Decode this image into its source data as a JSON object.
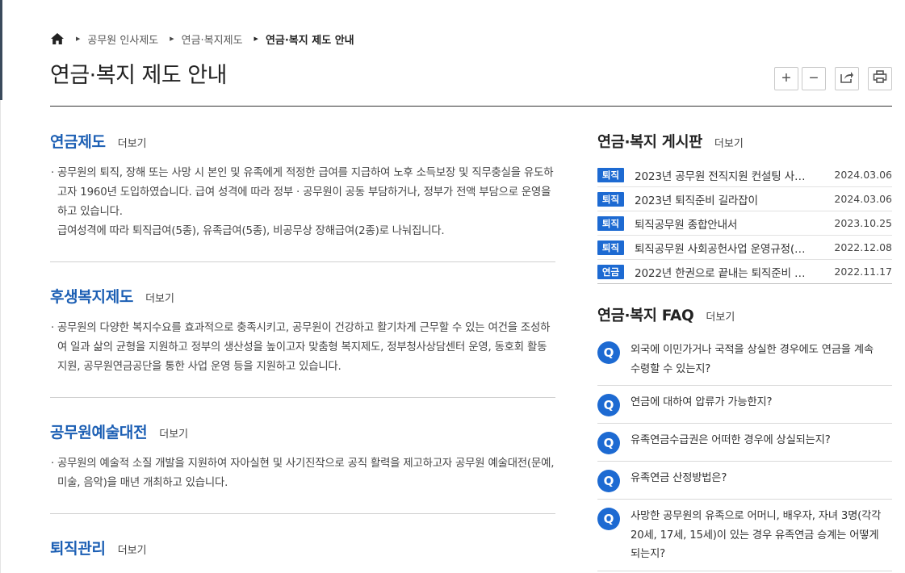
{
  "breadcrumb": {
    "items": [
      "공무원 인사제도",
      "연금·복지제도",
      "연금·복지 제도 안내"
    ]
  },
  "page": {
    "title": "연금·복지 제도 안내"
  },
  "tools": {
    "zoom_in": "+",
    "zoom_out": "−"
  },
  "more_label": "더보기",
  "sections": [
    {
      "title": "연금제도",
      "body": "공무원의 퇴직, 장해 또는 사망 시 본인 및 유족에게 적정한 급여를 지급하여 노후 소득보장 및 직무충실을 유도하고자 1960년 도입하였습니다. 급여 성격에 따라 정부 · 공무원이 공동 부담하거나, 정부가 전액 부담으로 운영을 하고 있습니다.",
      "body2": "급여성격에 따라 퇴직급여(5종), 유족급여(5종), 비공무상 장해급여(2종)로 나눠집니다."
    },
    {
      "title": "후생복지제도",
      "body": "공무원의 다양한 복지수요를 효과적으로 충족시키고, 공무원이 건강하고 활기차게 근무할 수 있는 여건을 조성하여 일과 삶의 균형을 지원하고 정부의 생산성을 높이고자 맞춤형 복지제도, 정부청사상담센터 운영, 동호회 활동 지원, 공무원연금공단을 통한 사업 운영 등을 지원하고 있습니다."
    },
    {
      "title": "공무원예술대전",
      "body": "공무원의 예술적 소질 개발을 지원하여 자아실현 및 사기진작으로 공직 활력을 제고하고자 공무원 예술대전(문예, 미술, 음악)을 매년 개최하고 있습니다."
    },
    {
      "title": "퇴직관리"
    }
  ],
  "board": {
    "title": "연금·복지 게시판",
    "items": [
      {
        "badge": "퇴직",
        "title": "2023년 공무원 전직지원 컨설팅 사…",
        "date": "2024.03.06"
      },
      {
        "badge": "퇴직",
        "title": "2023년 퇴직준비 길라잡이",
        "date": "2024.03.06"
      },
      {
        "badge": "퇴직",
        "title": "퇴직공무원 종합안내서",
        "date": "2023.10.25"
      },
      {
        "badge": "퇴직",
        "title": "퇴직공무원 사회공헌사업 운영규정(…",
        "date": "2022.12.08"
      },
      {
        "badge": "연금",
        "title": "2022년 한권으로 끝내는 퇴직준비 …",
        "date": "2022.11.17"
      }
    ]
  },
  "faq": {
    "title": "연금·복지 FAQ",
    "q_label": "Q",
    "items": [
      "외국에 이민가거나 국적을 상실한 경우에도 연금을 계속 수령할 수 있는지?",
      "연금에 대하여 압류가 가능한지?",
      "유족연금수급권은 어떠한 경우에 상실되는지?",
      "유족연금 산정방법은?",
      "사망한 공무원의 유족으로 어머니, 배우자, 자녀 3명(각각 20세, 17세, 15세)이 있는 경우 유족연금 승계는 어떻게 되는지?"
    ]
  }
}
